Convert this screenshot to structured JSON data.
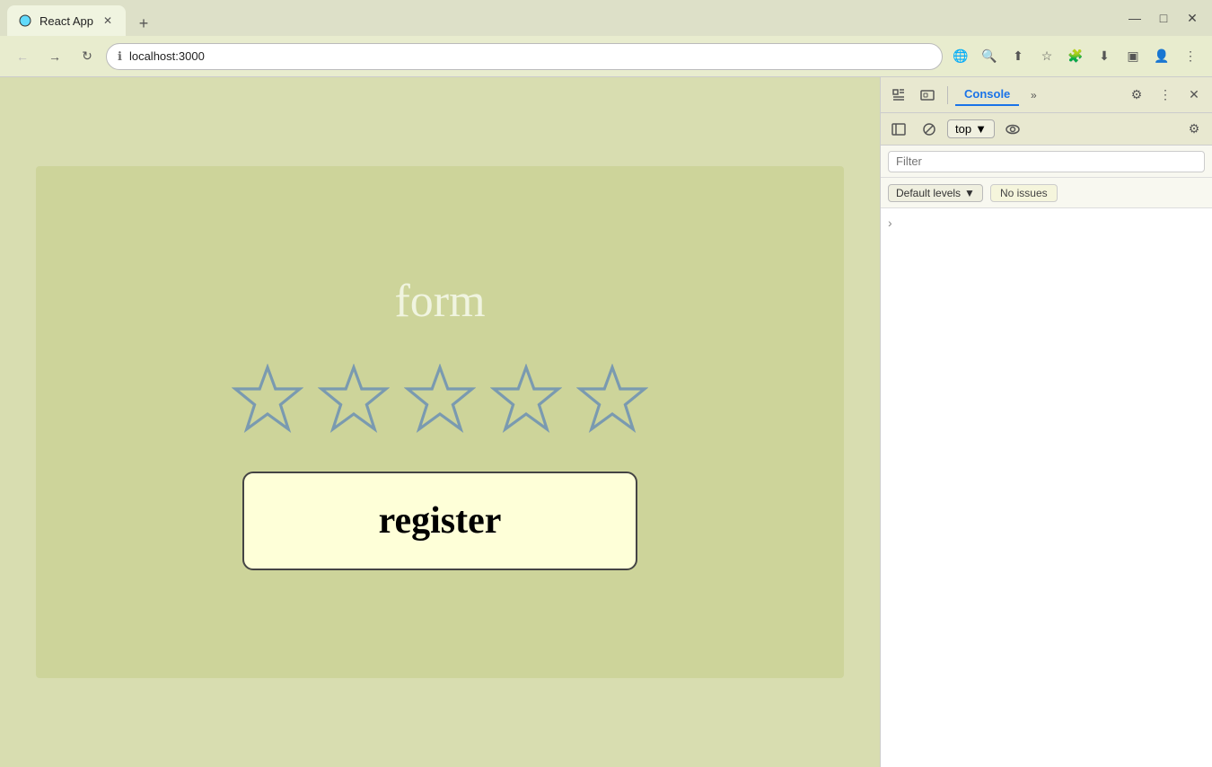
{
  "browser": {
    "tab_title": "React App",
    "url": "localhost:3000",
    "new_tab_label": "+",
    "window_controls": {
      "minimize": "—",
      "maximize": "□",
      "close": "✕"
    },
    "nav": {
      "back": "←",
      "forward": "→",
      "refresh": "↻"
    }
  },
  "toolbar_icons": {
    "translate": "🌐",
    "zoom": "🔍",
    "share": "⬆",
    "bookmark": "☆",
    "extensions": "🧩",
    "download": "⬇",
    "sidebar": "▣",
    "profile": "👤",
    "menu": "⋮"
  },
  "app": {
    "title": "form",
    "star_count": 5,
    "register_button": "register"
  },
  "devtools": {
    "toolbar": {
      "inspect_icon": "⊹",
      "device_icon": "▣",
      "console_tab": "Console",
      "more_tabs": "»",
      "settings_icon": "⚙",
      "more_menu": "⋮",
      "close_icon": "✕"
    },
    "secondary_toolbar": {
      "sidebar_icon": "▣",
      "ban_icon": "⊘",
      "top_label": "top",
      "eye_icon": "👁",
      "settings_icon": "⚙"
    },
    "filter_placeholder": "Filter",
    "levels": {
      "default_label": "Default levels",
      "issues_label": "No issues"
    },
    "console_arrow": "›"
  }
}
